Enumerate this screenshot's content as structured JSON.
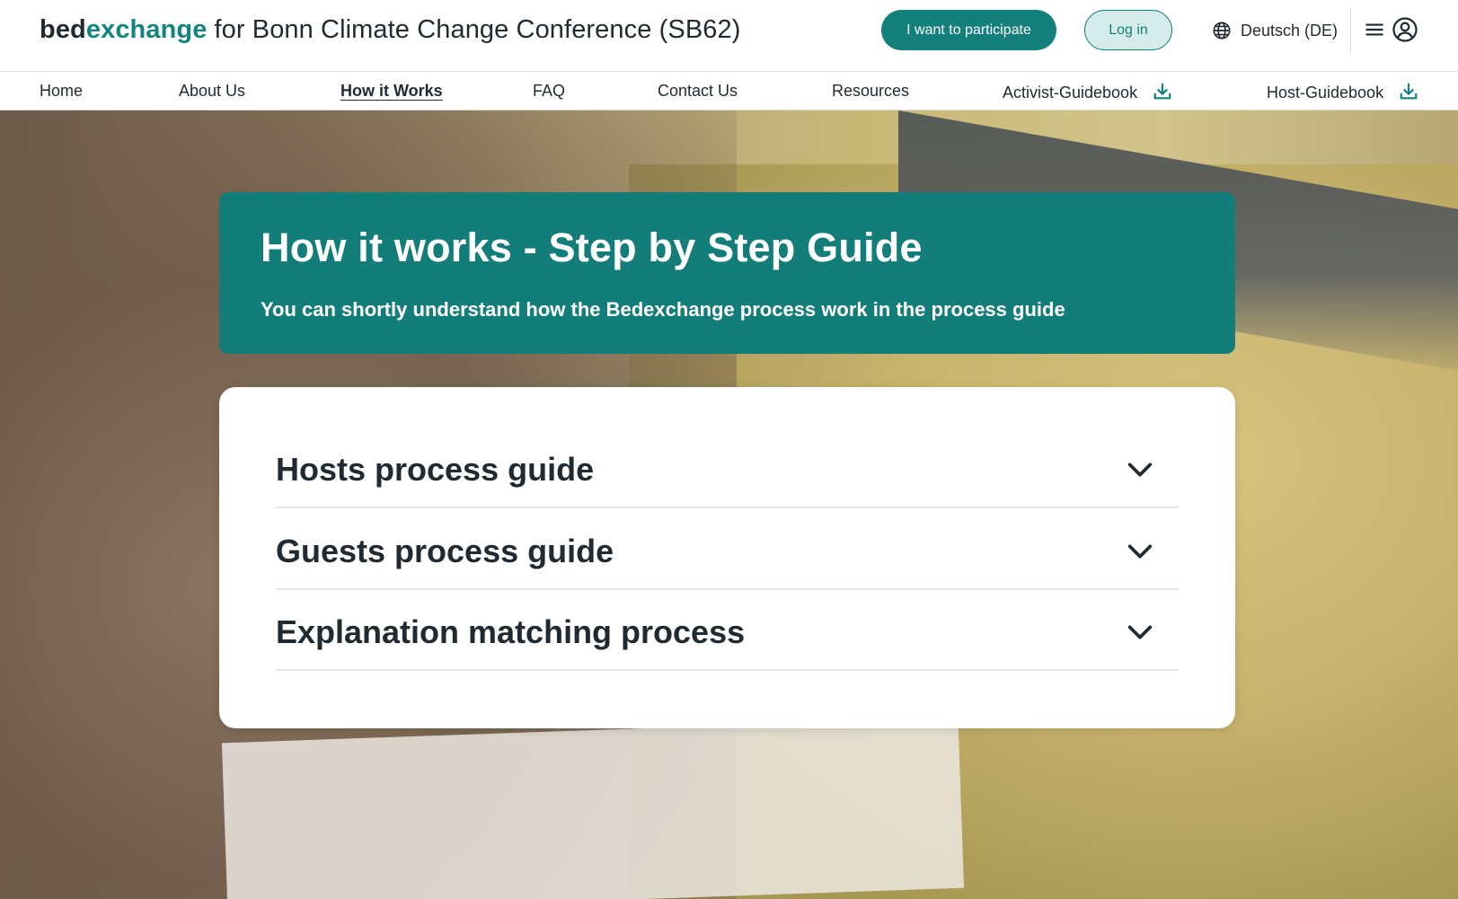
{
  "header": {
    "brand_bed": "bed",
    "brand_exchange": "exchange",
    "brand_subtitle": "for Bonn Climate Change Conference (SB62)",
    "participate_label": "I want to participate",
    "login_label": "Log in",
    "language_label": "Deutsch (DE)",
    "icons": {
      "language": "globe-icon",
      "menu": "hamburger-menu-icon",
      "account": "user-circle-icon"
    }
  },
  "nav": {
    "items": [
      {
        "label": "Home",
        "active": false
      },
      {
        "label": "About Us",
        "active": false
      },
      {
        "label": "How it Works",
        "active": true
      },
      {
        "label": "FAQ",
        "active": false
      },
      {
        "label": "Contact Us",
        "active": false
      },
      {
        "label": "Resources",
        "active": false
      },
      {
        "label": "Activist-Guidebook",
        "active": false,
        "icon": "download-icon"
      },
      {
        "label": "Host-Guidebook",
        "active": false,
        "icon": "download-icon"
      }
    ]
  },
  "hero": {
    "title": "How it works - Step by Step Guide",
    "subtitle": "You can shortly understand how the Bedexchange process work in the process guide"
  },
  "accordion": {
    "items": [
      {
        "label": "Hosts process guide",
        "expanded": false
      },
      {
        "label": "Guests process guide",
        "expanded": false
      },
      {
        "label": "Explanation matching process",
        "expanded": false
      }
    ]
  },
  "colors": {
    "brand_teal": "#13807c",
    "title_panel": "#137d79",
    "login_bg": "#d5eceb",
    "text_dark": "#1f2a33"
  }
}
